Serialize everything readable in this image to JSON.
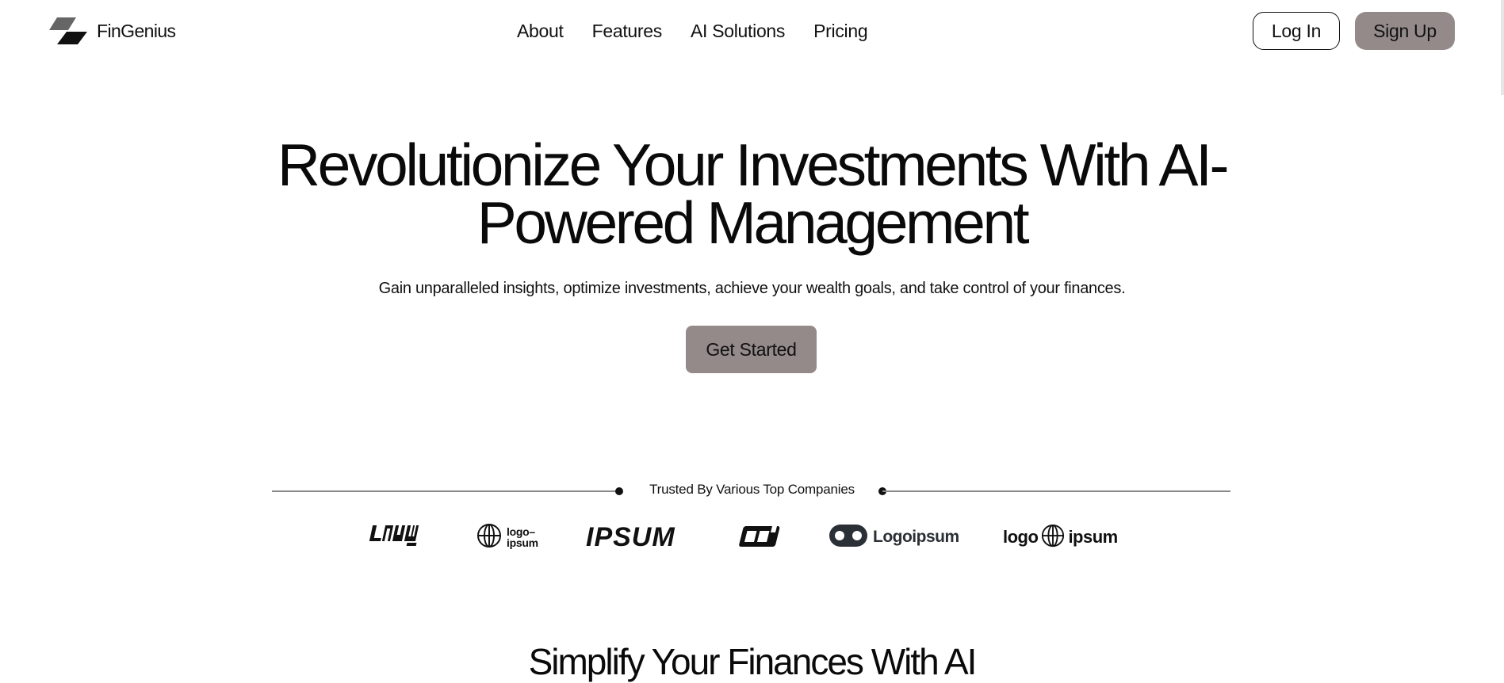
{
  "brand": {
    "name": "FinGenius",
    "logo_icon": "stacked-parallelogram-logo"
  },
  "nav": {
    "links": [
      {
        "label": "About"
      },
      {
        "label": "Features"
      },
      {
        "label": "AI Solutions"
      },
      {
        "label": "Pricing"
      }
    ],
    "login_label": "Log In",
    "signup_label": "Sign Up"
  },
  "hero": {
    "title_line1": "Revolutionize Your Investments With AI-",
    "title_line2": "Powered Management",
    "subtitle": "Gain unparalleled insights, optimize investments, achieve your wealth goals, and take control of your finances.",
    "cta_label": "Get Started"
  },
  "trusted": {
    "heading": "Trusted By Various Top Companies",
    "logos": [
      {
        "icon": "logo-wordmark-stylized-icon"
      },
      {
        "icon": "globe-icon",
        "text": "logo–ipsum"
      },
      {
        "icon": "ipsum-wordmark-icon",
        "text": "IPSUM"
      },
      {
        "icon": "box-mark-icon"
      },
      {
        "icon": "robot-face-icon",
        "text": "Logoipsum"
      },
      {
        "icon": "globe-icon",
        "text_left": "logo",
        "text_right": "ipsum"
      }
    ]
  },
  "next_section": {
    "title": "Simplify Your Finances With AI"
  },
  "colors": {
    "accent_button": "#948a8a",
    "text": "#111111",
    "background": "#ffffff"
  }
}
